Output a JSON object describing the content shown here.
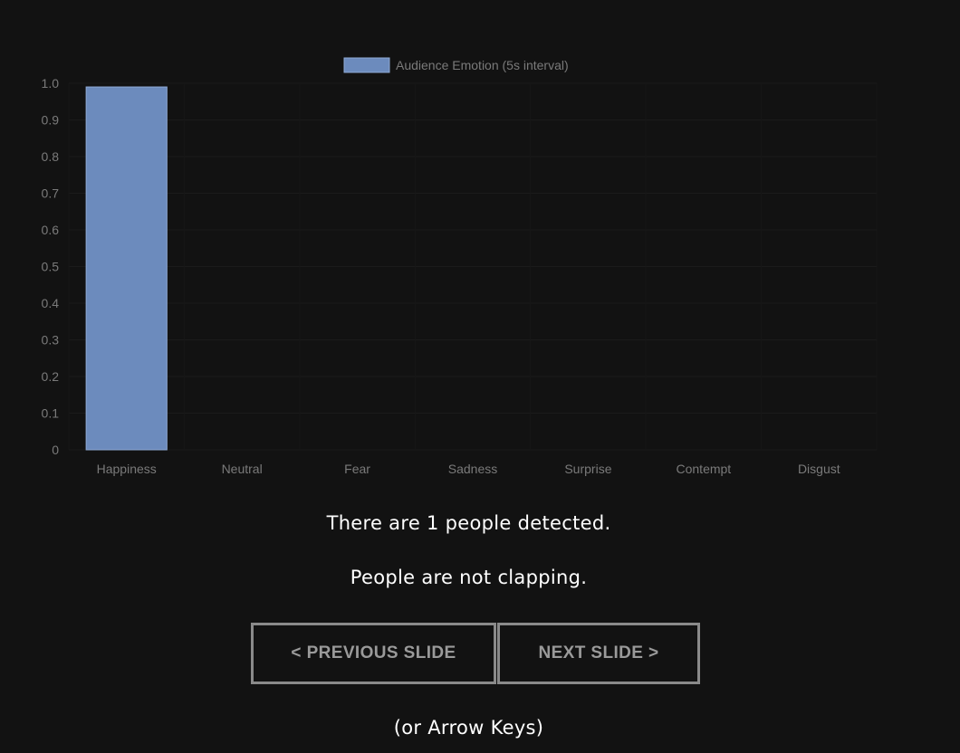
{
  "chart_data": {
    "type": "bar",
    "legend": "Audience Emotion (5s interval)",
    "legend_placement": "top",
    "categories": [
      "Happiness",
      "Neutral",
      "Fear",
      "Sadness",
      "Surprise",
      "Contempt",
      "Disgust"
    ],
    "values": [
      0.99,
      0,
      0,
      0,
      0,
      0,
      0
    ],
    "ylim": [
      0,
      1.0
    ],
    "yticks": [
      "0",
      "0.1",
      "0.2",
      "0.3",
      "0.4",
      "0.5",
      "0.6",
      "0.7",
      "0.8",
      "0.9",
      "1.0"
    ],
    "grid": true,
    "bar_color": "#6c8bbd",
    "bar_border_color": "#8fa9d4"
  },
  "status": {
    "people_detected": "There are 1 people detected.",
    "clapping": "People are not clapping."
  },
  "nav": {
    "previous_label": "< PREVIOUS SLIDE",
    "next_label": "NEXT SLIDE >",
    "hint": "(or Arrow Keys)"
  },
  "colors": {
    "background": "#121212",
    "text": "#ffffff",
    "muted_text": "#7a7a7a",
    "button_border": "#8a8a8a",
    "button_text": "#9a9a9a"
  }
}
